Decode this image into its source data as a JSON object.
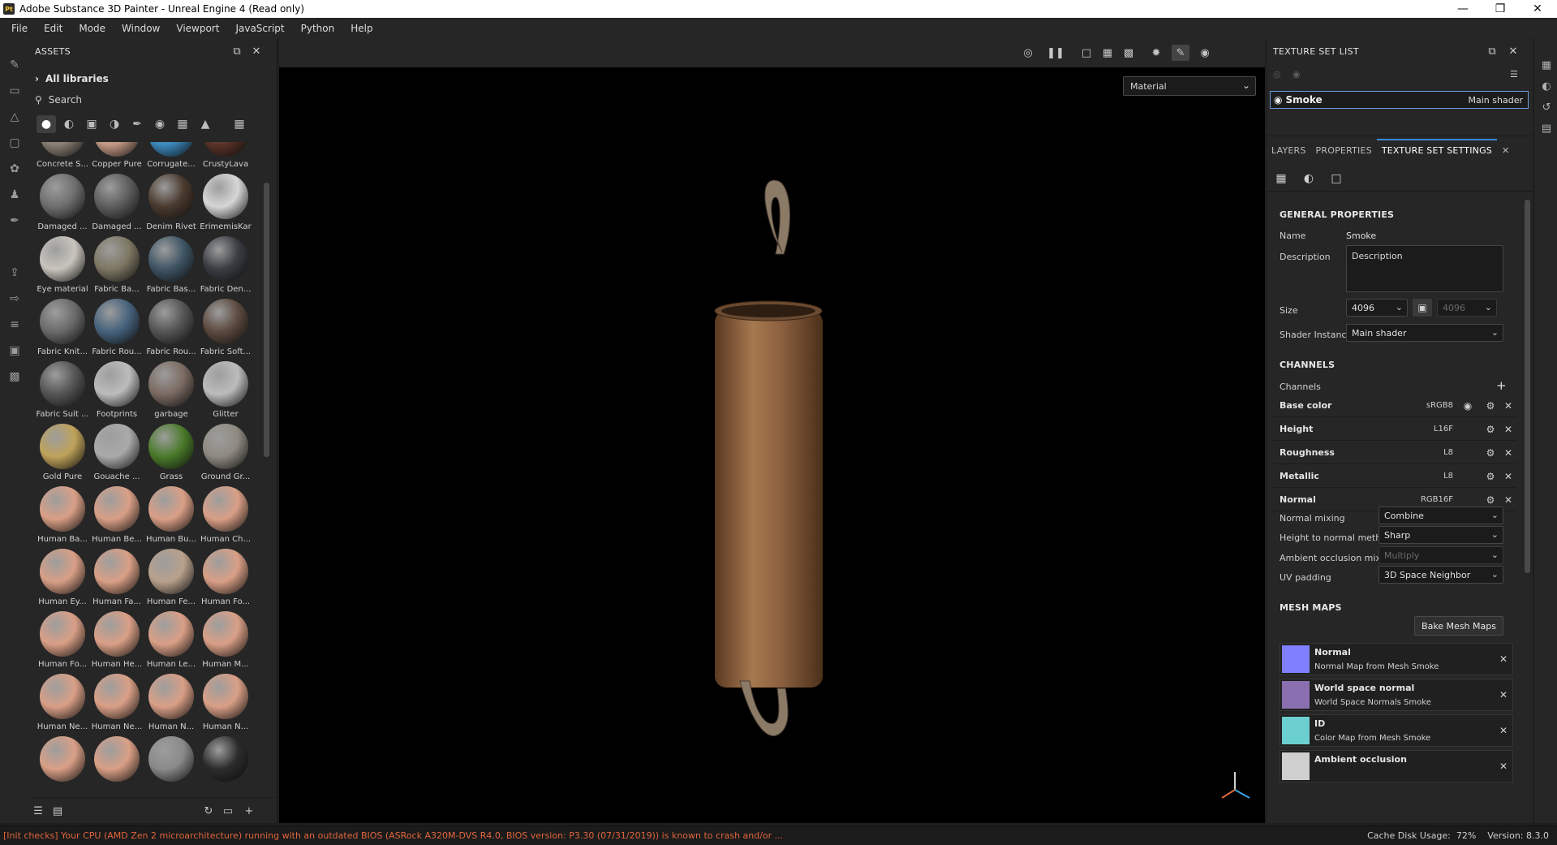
{
  "window": {
    "title": "Adobe Substance 3D Painter - Unreal Engine 4 (Read only)",
    "app_badge": "Pt"
  },
  "menu": [
    "File",
    "Edit",
    "Mode",
    "Window",
    "Viewport",
    "JavaScript",
    "Python",
    "Help"
  ],
  "assets": {
    "panel_title": "ASSETS",
    "library": "All libraries",
    "search_placeholder": "Search",
    "items": [
      {
        "label": "Concrete S...",
        "color": "#8a8175"
      },
      {
        "label": "Copper Pure",
        "color": "#c59a86"
      },
      {
        "label": "Corrugate...",
        "color": "#3d8ac0"
      },
      {
        "label": "CrustyLava",
        "color": "#5a3328"
      },
      {
        "label": "Damaged ...",
        "color": "#6e6e6e"
      },
      {
        "label": "Damaged ...",
        "color": "#5d5d5d"
      },
      {
        "label": "Denim Rivet",
        "color": "#4a3a2e"
      },
      {
        "label": "ErimemisKar",
        "color": "#d6d6d6"
      },
      {
        "label": "Eye material",
        "color": "#c8c4bd"
      },
      {
        "label": "Fabric Ba...",
        "color": "#7d7763"
      },
      {
        "label": "Fabric Bas...",
        "color": "#3f5565"
      },
      {
        "label": "Fabric Den...",
        "color": "#3a3d43"
      },
      {
        "label": "Fabric Knit...",
        "color": "#6a6a6a"
      },
      {
        "label": "Fabric Rou...",
        "color": "#46627c"
      },
      {
        "label": "Fabric Rou...",
        "color": "#555555"
      },
      {
        "label": "Fabric Soft...",
        "color": "#5c4a3f"
      },
      {
        "label": "Fabric Suit ...",
        "color": "#555555"
      },
      {
        "label": "Footprints",
        "color": "#bcbcbc"
      },
      {
        "label": "garbage",
        "color": "#7b6b62"
      },
      {
        "label": "Glitter",
        "color": "#bcbcbc"
      },
      {
        "label": "Gold Pure",
        "color": "#bfa25a"
      },
      {
        "label": "Gouache ...",
        "color": "#aaaaaa"
      },
      {
        "label": "Grass",
        "color": "#4a7a2a"
      },
      {
        "label": "Ground Gr...",
        "color": "#8e8a80"
      },
      {
        "label": "Human Ba...",
        "color": "#d99f86"
      },
      {
        "label": "Human Be...",
        "color": "#d99f86"
      },
      {
        "label": "Human Bu...",
        "color": "#d99f86"
      },
      {
        "label": "Human Ch...",
        "color": "#d99f86"
      },
      {
        "label": "Human Ey...",
        "color": "#d99f86"
      },
      {
        "label": "Human Fa...",
        "color": "#d99f86"
      },
      {
        "label": "Human Fe...",
        "color": "#b8a08c"
      },
      {
        "label": "Human Fo...",
        "color": "#d99f86"
      },
      {
        "label": "Human Fo...",
        "color": "#d99f86"
      },
      {
        "label": "Human He...",
        "color": "#d99f86"
      },
      {
        "label": "Human Le...",
        "color": "#d99f86"
      },
      {
        "label": "Human M...",
        "color": "#d99f86"
      },
      {
        "label": "Human Ne...",
        "color": "#d99f86"
      },
      {
        "label": "Human Ne...",
        "color": "#d99f86"
      },
      {
        "label": "Human N...",
        "color": "#d99f86"
      },
      {
        "label": "Human N...",
        "color": "#d99f86"
      },
      {
        "label": "",
        "color": "#d99f86"
      },
      {
        "label": "",
        "color": "#d99f86"
      },
      {
        "label": "",
        "color": "#8a8a8a"
      },
      {
        "label": "",
        "color": "#2c2c2c"
      }
    ]
  },
  "viewport": {
    "mode_select": "Material"
  },
  "texture_set_list": {
    "title": "TEXTURE SET LIST",
    "row_name": "Smoke",
    "row_shader": "Main shader"
  },
  "tabs": {
    "layers": "LAYERS",
    "properties": "PROPERTIES",
    "texture_set_settings": "TEXTURE SET SETTINGS"
  },
  "general": {
    "title": "GENERAL PROPERTIES",
    "name_label": "Name",
    "name_value": "Smoke",
    "description_label": "Description",
    "description_value": "Description",
    "size_label": "Size",
    "size_value": "4096",
    "size_value_locked": "4096",
    "shader_label": "Shader Instance",
    "shader_value": "Main shader"
  },
  "channels": {
    "title": "CHANNELS",
    "label": "Channels",
    "rows": [
      {
        "name": "Base color",
        "format": "sRGB8"
      },
      {
        "name": "Height",
        "format": "L16F"
      },
      {
        "name": "Roughness",
        "format": "L8"
      },
      {
        "name": "Metallic",
        "format": "L8"
      },
      {
        "name": "Normal",
        "format": "RGB16F"
      }
    ],
    "normal_mixing_label": "Normal mixing",
    "normal_mixing_value": "Combine",
    "height_normal_label": "Height to normal method",
    "height_normal_value": "Sharp",
    "ao_mixing_label": "Ambient occlusion mixing",
    "ao_mixing_value": "Multiply",
    "uv_padding_label": "UV padding",
    "uv_padding_value": "3D Space Neighbor"
  },
  "mesh_maps": {
    "title": "MESH MAPS",
    "bake_button": "Bake Mesh Maps",
    "rows": [
      {
        "name": "Normal",
        "sub": "Normal Map from Mesh Smoke",
        "color": "#7f7fff"
      },
      {
        "name": "World space normal",
        "sub": "World Space Normals Smoke",
        "color": "#8a6fb0"
      },
      {
        "name": "ID",
        "sub": "Color Map from Mesh Smoke",
        "color": "#6ccfcf"
      },
      {
        "name": "Ambient occlusion",
        "sub": "",
        "color": "#cfcfcf"
      }
    ]
  },
  "status": {
    "message": "[Init checks] Your CPU (AMD Zen 2 microarchitecture) running with an outdated BIOS (ASRock A320M-DVS R4.0, BIOS version: P3.30 (07/31/2019)) is known to crash and/or ...",
    "cache": "Cache Disk Usage:",
    "cache_pct": "72%",
    "version": "Version: 8.3.0"
  }
}
